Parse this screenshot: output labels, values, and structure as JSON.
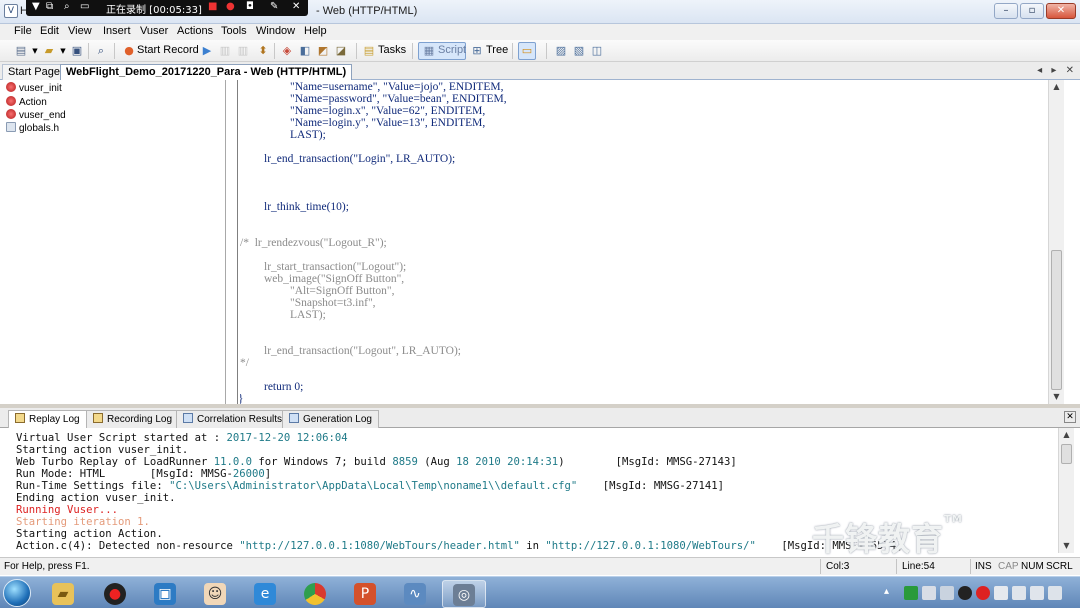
{
  "window": {
    "title_prefix": "H",
    "title": "- Web (HTTP/HTML)"
  },
  "recorder": {
    "label": "正在录制 [00:05:33]"
  },
  "menu": {
    "items": [
      "File",
      "Edit",
      "View",
      "Insert",
      "Vuser",
      "Actions",
      "Tools",
      "Window",
      "Help"
    ]
  },
  "toolbar": {
    "start_record": "Start Record",
    "tasks": "Tasks",
    "script": "Script",
    "tree": "Tree"
  },
  "doc_tabs": {
    "start_page": "Start Page",
    "active": "WebFlight_Demo_20171220_Para - Web (HTTP/HTML)"
  },
  "tree": {
    "items": [
      "vuser_init",
      "Action",
      "vuser_end",
      "globals.h"
    ]
  },
  "code": {
    "lines": [
      "\"Name=username\", \"Value=jojo\", ENDITEM,",
      "\"Name=password\", \"Value=bean\", ENDITEM,",
      "\"Name=login.x\", \"Value=62\", ENDITEM,",
      "\"Name=login.y\", \"Value=13\", ENDITEM,",
      "LAST);",
      "lr_end_transaction(\"Login\", LR_AUTO);",
      "lr_think_time(10);",
      "/*  lr_rendezvous(\"Logout_R\");",
      "lr_start_transaction(\"Logout\");",
      "web_image(\"SignOff Button\",",
      "\"Alt=SignOff Button\",",
      "\"Snapshot=t3.inf\",",
      "LAST);",
      "lr_end_transaction(\"Logout\", LR_AUTO);",
      "*/",
      "return 0;",
      "}"
    ]
  },
  "log_tabs": {
    "replay": "Replay Log",
    "recording": "Recording Log",
    "correlation": "Correlation Results",
    "generation": "Generation Log"
  },
  "log": {
    "lines": [
      "Virtual User Script started at : ",
      "2017-12-20 12:06:04",
      "Starting action vuser_init.",
      "Web Turbo Replay of LoadRunner ",
      "11.0.0",
      " for Windows 7; build ",
      "8859",
      " (Aug ",
      "18 2010 20:14:31",
      ")        [MsgId: MMSG-27143]",
      "Run Mode: HTML       [MsgId: MMSG-",
      "26000",
      "]",
      "Run-Time Settings file: ",
      "\"C:\\Users\\Administrator\\AppData\\Local\\Temp\\noname1\\\\default.cfg\"",
      "    [MsgId: MMSG-27141]",
      "Ending action vuser_init.",
      "Running Vuser...",
      "Starting iteration 1.",
      "Starting action Action.",
      "Action.c(4): Detected non-resource ",
      "\"http://127.0.0.1:1080/WebTours/header.html\"",
      " in ",
      "\"http://127.0.0.1:1080/WebTours/\"",
      "    [MsgId: MMSG-26574]"
    ]
  },
  "watermark": {
    "text": "千锋教育",
    "tm": "TM"
  },
  "status": {
    "help": "For Help, press F1.",
    "col": "Col:3",
    "line": "Line:54",
    "ins": "INS",
    "cap": "CAP",
    "num": "NUM",
    "scrl": "SCRL"
  },
  "colors": {
    "code_blue": "#102a7a",
    "comment_gray": "#8b8b8b",
    "log_teal": "#1f7a88",
    "log_red": "#dd2222"
  }
}
